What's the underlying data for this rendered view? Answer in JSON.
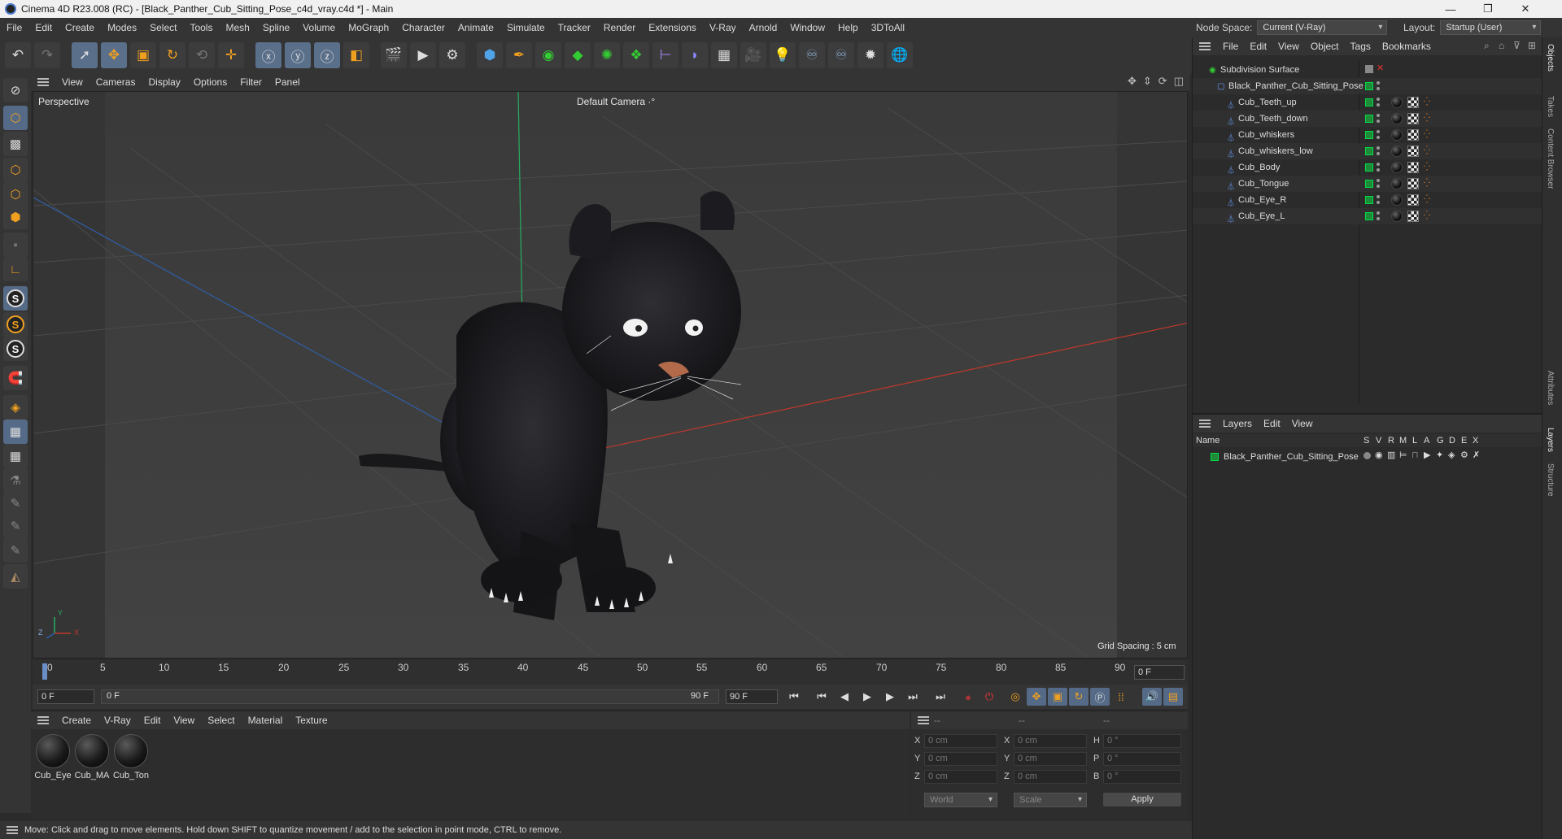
{
  "window": {
    "title": "Cinema 4D R23.008 (RC) - [Black_Panther_Cub_Sitting_Pose_c4d_vray.c4d *] - Main",
    "minimize": "—",
    "maximize": "❐",
    "close": "✕"
  },
  "menubar": {
    "items": [
      "File",
      "Edit",
      "Create",
      "Modes",
      "Select",
      "Tools",
      "Mesh",
      "Spline",
      "Volume",
      "MoGraph",
      "Character",
      "Animate",
      "Simulate",
      "Tracker",
      "Render",
      "Extensions",
      "V-Ray",
      "Arnold",
      "Window",
      "Help",
      "3DToAll"
    ],
    "node_space_label": "Node Space:",
    "node_space_value": "Current (V-Ray)",
    "layout_label": "Layout:",
    "layout_value": "Startup (User)"
  },
  "viewport_menu": {
    "items": [
      "View",
      "Cameras",
      "Display",
      "Options",
      "Filter",
      "Panel"
    ]
  },
  "viewport": {
    "label": "Perspective",
    "camera": "Default Camera",
    "camera_suffix": "·°",
    "grid_spacing": "Grid Spacing : 5 cm",
    "axis_x": "X",
    "axis_y": "Y",
    "axis_z": "Z"
  },
  "timeline": {
    "ticks": [
      "0",
      "5",
      "10",
      "15",
      "20",
      "25",
      "30",
      "35",
      "40",
      "45",
      "50",
      "55",
      "60",
      "65",
      "70",
      "75",
      "80",
      "85",
      "90"
    ],
    "current_frame": "0 F",
    "start_frame": "0 F",
    "range_start": "0 F",
    "range_end": "90 F",
    "end_frame": "90 F"
  },
  "material_menu": {
    "items": [
      "Create",
      "V-Ray",
      "Edit",
      "View",
      "Select",
      "Material",
      "Texture"
    ]
  },
  "materials": [
    "Cub_Eye",
    "Cub_MA",
    "Cub_Ton"
  ],
  "coords": {
    "header": [
      "--",
      "--",
      "--"
    ],
    "rows": [
      {
        "a": "X",
        "av": "0 cm",
        "b": "X",
        "bv": "0 cm",
        "c": "H",
        "cv": "0 °"
      },
      {
        "a": "Y",
        "av": "0 cm",
        "b": "Y",
        "bv": "0 cm",
        "c": "P",
        "cv": "0 °"
      },
      {
        "a": "Z",
        "av": "0 cm",
        "b": "Z",
        "bv": "0 cm",
        "c": "B",
        "cv": "0 °"
      }
    ],
    "space": "World",
    "mode": "Scale",
    "apply": "Apply"
  },
  "status": "Move: Click and drag to move elements. Hold down SHIFT to quantize movement / add to the selection in point mode, CTRL to remove.",
  "object_manager": {
    "menu": [
      "File",
      "Edit",
      "View",
      "Object",
      "Tags",
      "Bookmarks"
    ],
    "objects": [
      {
        "name": "Subdivision Surface",
        "level": 0
      },
      {
        "name": "Black_Panther_Cub_Sitting_Pose",
        "level": 1
      },
      {
        "name": "Cub_Teeth_up",
        "level": 2
      },
      {
        "name": "Cub_Teeth_down",
        "level": 2
      },
      {
        "name": "Cub_whiskers",
        "level": 2
      },
      {
        "name": "Cub_whiskers_low",
        "level": 2
      },
      {
        "name": "Cub_Body",
        "level": 2
      },
      {
        "name": "Cub_Tongue",
        "level": 2
      },
      {
        "name": "Cub_Eye_R",
        "level": 2
      },
      {
        "name": "Cub_Eye_L",
        "level": 2
      }
    ]
  },
  "layers": {
    "menu": [
      "Layers",
      "Edit",
      "View"
    ],
    "name_header": "Name",
    "columns": [
      "S",
      "V",
      "R",
      "M",
      "L",
      "A",
      "G",
      "D",
      "E",
      "X"
    ],
    "items": [
      "Black_Panther_Cub_Sitting_Pose"
    ]
  },
  "side_tabs": [
    "Objects",
    "Takes",
    "Content Browser",
    "Attributes",
    "Layers",
    "Structure"
  ],
  "colors": {
    "accent": "#5a6f8a",
    "x_axis": "#c0392b",
    "y_axis": "#27ae60",
    "z_axis": "#2e5fa8",
    "layer_green": "#1f8a3a"
  }
}
